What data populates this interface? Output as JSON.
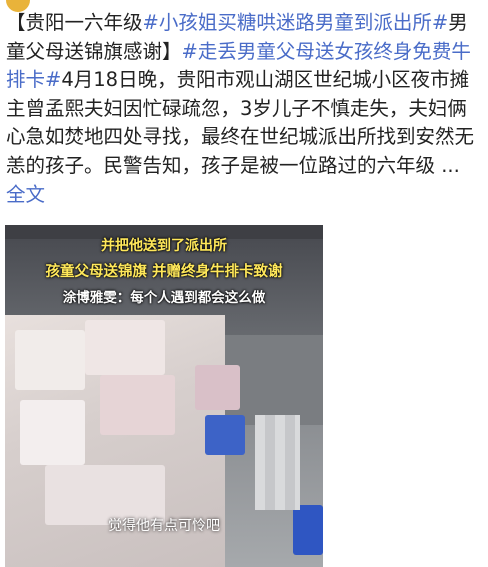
{
  "post": {
    "segments": [
      {
        "type": "text",
        "text": "【贵阳一六年级"
      },
      {
        "type": "tag",
        "text": "#小孩姐买糖哄迷路男童到派出所#"
      },
      {
        "type": "text",
        "text": "男童父母送锦旗感谢】"
      },
      {
        "type": "tag",
        "text": "#走丢男童父母送女孩终身免费牛排卡#"
      },
      {
        "type": "text",
        "text": "4月18日晚，贵阳市观山湖区世纪城小区夜市摊主曾孟熙夫妇因忙碌疏忽，3岁儿子不慎走失，夫妇俩心急如焚地四处寻找，最终在世纪城派出所找到安然无恙的孩子。民警告知，孩子是被一位路过的六年级 ... "
      }
    ],
    "more_link": "全文"
  },
  "video": {
    "caption_top": "并把他送到了派出所",
    "caption_mid": "孩童父母送锦旗 并赠终身牛排卡致谢",
    "caption_quote": "涂博雅雯：每个人遇到都会这么做",
    "subtitle": "觉得他有点可怜吧"
  }
}
